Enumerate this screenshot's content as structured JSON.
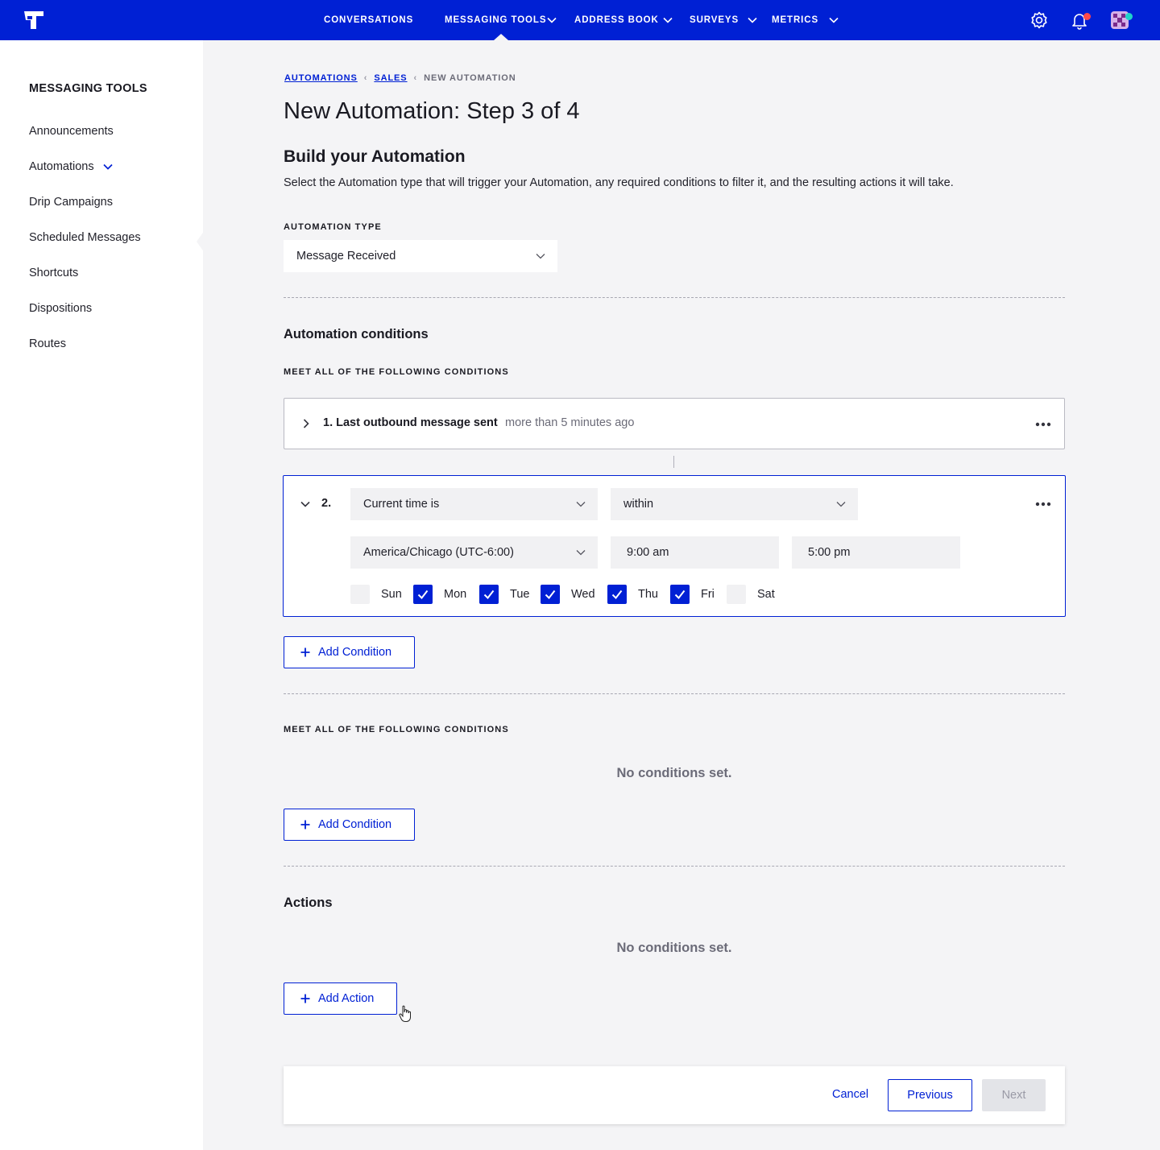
{
  "nav": {
    "items": [
      {
        "label": "CONVERSATIONS",
        "has_chevron": false,
        "active": false
      },
      {
        "label": "MESSAGING TOOLS",
        "has_chevron": true,
        "active": true
      },
      {
        "label": "ADDRESS BOOK",
        "has_chevron": true,
        "active": false
      },
      {
        "label": "SURVEYS",
        "has_chevron": true,
        "active": false
      },
      {
        "label": "METRICS",
        "has_chevron": true,
        "active": false
      }
    ],
    "icons": [
      "gear-icon",
      "bell-icon",
      "avatar"
    ],
    "notification_dot_color": "#ff4a4a",
    "status_dot_color": "#1fd3c9",
    "background": "#0020d4"
  },
  "sidebar": {
    "title": "MESSAGING TOOLS",
    "items": [
      {
        "label": "Announcements"
      },
      {
        "label": "Automations",
        "expanded": true
      },
      {
        "label": "Drip Campaigns"
      },
      {
        "label": "Scheduled Messages"
      },
      {
        "label": "Shortcuts"
      },
      {
        "label": "Dispositions"
      },
      {
        "label": "Routes"
      }
    ]
  },
  "breadcrumb": {
    "items": [
      "AUTOMATIONS",
      "SALES"
    ],
    "current": "NEW AUTOMATION"
  },
  "page": {
    "title": "New Automation: Step 3 of 4",
    "subtitle": "Build your Automation",
    "description": "Select the Automation type that will trigger your Automation, any required conditions to filter it, and the resulting actions it will take."
  },
  "automation_type": {
    "label": "AUTOMATION TYPE",
    "value": "Message Received"
  },
  "conditions": {
    "title": "Automation conditions",
    "group1": {
      "label": "MEET ALL OF THE FOLLOWING CONDITIONS",
      "condition1": {
        "label": "1. Last outbound message sent",
        "value": "more than 5 minutes ago"
      },
      "condition2": {
        "number": "2.",
        "field": "Current time is",
        "operator": "within",
        "timezone": "America/Chicago (UTC-6:00)",
        "start_time": "9:00 am",
        "end_time": "5:00 pm",
        "days": [
          {
            "label": "Sun",
            "checked": false
          },
          {
            "label": "Mon",
            "checked": true
          },
          {
            "label": "Tue",
            "checked": true
          },
          {
            "label": "Wed",
            "checked": true
          },
          {
            "label": "Thu",
            "checked": true
          },
          {
            "label": "Fri",
            "checked": true
          },
          {
            "label": "Sat",
            "checked": false
          }
        ]
      },
      "add_label": "Add Condition"
    },
    "group2": {
      "label": "MEET ALL OF THE FOLLOWING CONDITIONS",
      "empty": "No conditions set.",
      "add_label": "Add Condition"
    }
  },
  "actions": {
    "title": "Actions",
    "empty": "No conditions set.",
    "add_label": "Add Action"
  },
  "footer": {
    "cancel": "Cancel",
    "previous": "Previous",
    "next": "Next"
  }
}
